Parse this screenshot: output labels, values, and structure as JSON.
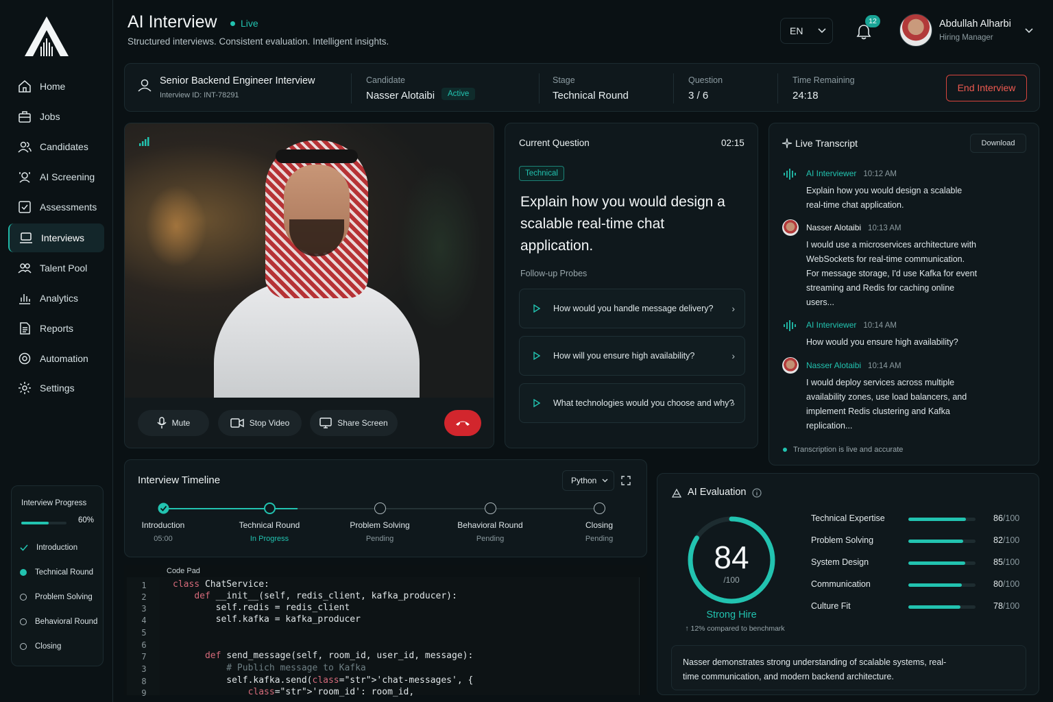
{
  "app": {
    "title": "AI Interview",
    "status": "Live",
    "subtitle": "Structured interviews. Consistent evaluation. Intelligent insights."
  },
  "header": {
    "language": "EN",
    "notifications": "12",
    "user_name": "Abdullah Alharbi",
    "user_role": "Hiring Manager"
  },
  "sidebar": {
    "items": [
      {
        "label": "Home",
        "icon": "home-icon"
      },
      {
        "label": "Jobs",
        "icon": "briefcase-icon"
      },
      {
        "label": "Candidates",
        "icon": "users-icon"
      },
      {
        "label": "AI Screening",
        "icon": "ai-screening-icon"
      },
      {
        "label": "Assessments",
        "icon": "assessment-icon"
      },
      {
        "label": "Interviews",
        "icon": "laptop-icon",
        "active": true
      },
      {
        "label": "Talent Pool",
        "icon": "talent-pool-icon"
      },
      {
        "label": "Analytics",
        "icon": "chart-icon"
      },
      {
        "label": "Reports",
        "icon": "report-icon"
      },
      {
        "label": "Automation",
        "icon": "automation-icon"
      },
      {
        "label": "Settings",
        "icon": "gear-icon"
      }
    ]
  },
  "progress": {
    "title": "Interview Progress",
    "percent": "60%",
    "fraction": 0.6,
    "items": [
      {
        "label": "Introduction",
        "state": "done"
      },
      {
        "label": "Technical Round",
        "state": "current"
      },
      {
        "label": "Problem Solving",
        "state": "pending"
      },
      {
        "label": "Behavioral Round",
        "state": "pending"
      },
      {
        "label": "Closing",
        "state": "pending"
      }
    ]
  },
  "info": {
    "title": "Senior Backend Engineer Interview",
    "id": "Interview ID: INT-78291",
    "candidate_label": "Candidate",
    "candidate": "Nasser Alotaibi",
    "candidate_status": "Active",
    "stage_label": "Stage",
    "stage": "Technical Round",
    "question_label": "Question",
    "question": "3 / 6",
    "time_label": "Time Remaining",
    "time": "24:18",
    "end_button": "End Interview"
  },
  "video": {
    "mute": "Mute",
    "stop_video": "Stop Video",
    "share_screen": "Share Screen"
  },
  "question": {
    "title": "Current Question",
    "timer": "02:15",
    "tag": "Technical",
    "text": "Explain how you would design a scalable real-time chat application.",
    "probes_title": "Follow-up Probes",
    "probes": [
      "How would you handle message delivery?",
      "How will you ensure high availability?",
      "What technologies would you choose and why?"
    ]
  },
  "transcript": {
    "title": "Live Transcript",
    "download": "Download",
    "messages": [
      {
        "speaker": "AI Interviewer",
        "time": "10:12 AM",
        "text": "Explain how you would design a scalable real-time chat application."
      },
      {
        "speaker": "Nasser Alotaibi",
        "time": "10:13 AM",
        "text": "I would use a microservices architecture with WebSockets for real-time communication. For message storage, I'd use Kafka for event streaming and Redis for caching online users..."
      },
      {
        "speaker": "AI Interviewer",
        "time": "10:14 AM",
        "text": "How would you ensure high availability?"
      },
      {
        "speaker": "Nasser Alotaibi",
        "time": "10:14 AM",
        "text": "I would deploy services across multiple availability zones, use load balancers, and implement Redis clustering and Kafka replication..."
      }
    ],
    "footer": "Transcription is live and accurate"
  },
  "timeline": {
    "title": "Interview Timeline",
    "language": "Python",
    "steps": [
      {
        "label": "Introduction",
        "sub": "05:00"
      },
      {
        "label": "Technical Round",
        "sub": "In Progress"
      },
      {
        "label": "Problem Solving",
        "sub": "Pending"
      },
      {
        "label": "Behavioral Round",
        "sub": "Pending"
      },
      {
        "label": "Closing",
        "sub": "Pending"
      }
    ]
  },
  "code": {
    "title": "Code Pad",
    "line_numbers": [
      "1",
      "2",
      "3",
      "4",
      "5",
      "6",
      "7",
      "3",
      "8",
      "9"
    ],
    "lines": [
      "class ChatService:",
      "    def __init__(self, redis_client, kafka_producer):",
      "        self.redis = redis_client",
      "        self.kafka = kafka_producer",
      "",
      "      def send_message(self, room_id, user_id, message):",
      "          # Publich message to Kafka",
      "          self.kafka.send('chat-messages', {",
      "              'room_id': room_id,"
    ]
  },
  "evaluation": {
    "title": "AI Evaluation",
    "score": "84",
    "score_max": "/100",
    "score_value": 84,
    "verdict": "Strong Hire",
    "benchmark": "↑ 12% compared to benchmark",
    "metrics": [
      {
        "label": "Technical Expertise",
        "score": "86",
        "value": 86
      },
      {
        "label": "Problem Solving",
        "score": "82",
        "value": 82
      },
      {
        "label": "System Design",
        "score": "85",
        "value": 85
      },
      {
        "label": "Communication",
        "score": "80",
        "value": 80
      },
      {
        "label": "Culture Fit",
        "score": "78",
        "value": 78
      }
    ],
    "metric_max": "/100",
    "summary": "Nasser demonstrates strong understanding of scalable systems, real-time communication, and modern backend architecture."
  },
  "colors": {
    "accent": "#22c3b0",
    "danger": "#e0463e",
    "background": "#0a1114"
  }
}
